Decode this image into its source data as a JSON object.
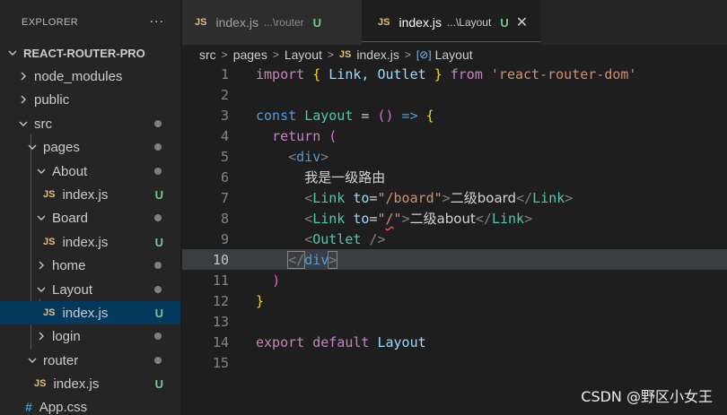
{
  "sidebar": {
    "title": "EXPLORER",
    "more_icon": "···",
    "root": "REACT-ROUTER-PRO",
    "items": {
      "node_modules": "node_modules",
      "public": "public",
      "src": "src",
      "pages": "pages",
      "about": "About",
      "about_index": "index.js",
      "board": "Board",
      "board_index": "index.js",
      "home": "home",
      "layout": "Layout",
      "layout_index": "index.js",
      "login": "login",
      "router": "router",
      "router_index": "index.js",
      "app_css": "App.css"
    },
    "js_badge": "JS",
    "css_badge": "#",
    "untracked": "U"
  },
  "tabs": [
    {
      "name": "index.js",
      "path": "...\\router",
      "status": "U"
    },
    {
      "name": "index.js",
      "path": "...\\Layout",
      "status": "U",
      "close": "✕"
    }
  ],
  "breadcrumb": {
    "parts": [
      "src",
      "pages",
      "Layout",
      "index.js",
      "Layout"
    ],
    "symbol_icon": "[⊘]"
  },
  "editor": {
    "line_numbers": [
      "1",
      "2",
      "3",
      "4",
      "5",
      "6",
      "7",
      "8",
      "9",
      "10",
      "11",
      "12",
      "13",
      "14",
      "15"
    ],
    "current_line": 10,
    "l1": {
      "import": "import",
      "open": "{",
      "names": " Link, Outlet ",
      "close": "}",
      "from": "from",
      "module": "'react-router-dom'"
    },
    "l3": {
      "const": "const",
      "name": "Layout",
      "eq": " = ",
      "paren": "()",
      "arrow": " => ",
      "brace": "{"
    },
    "l4": {
      "ret": "return",
      "paren": "("
    },
    "l5": {
      "lt": "<",
      "tag": "div",
      "gt": ">"
    },
    "l6": {
      "text": "我是一级路由"
    },
    "l7": {
      "lt": "<",
      "comp": "Link",
      "attr": "to",
      "eq": "=",
      "val": "\"/board\"",
      "gt": ">",
      "text": "二级board",
      "close_lt": "</",
      "close_comp": "Link",
      "close_gt": ">"
    },
    "l8": {
      "lt": "<",
      "comp": "Link",
      "attr": "to",
      "eq": "=",
      "q1": "\"",
      "val": "/",
      "q2": "\"",
      "gt": ">",
      "text": "二级about",
      "close_lt": "</",
      "close_comp": "Link",
      "close_gt": ">"
    },
    "l9": {
      "lt": "<",
      "comp": "Outlet",
      "self": " />"
    },
    "l10": {
      "lt": "</",
      "tag": "div",
      "gt": ">"
    },
    "l11": {
      "paren": ")"
    },
    "l12": {
      "brace": "}"
    },
    "l14": {
      "export": "export",
      "default": "default",
      "name": "Layout"
    }
  },
  "watermark": "CSDN @野区小女王"
}
